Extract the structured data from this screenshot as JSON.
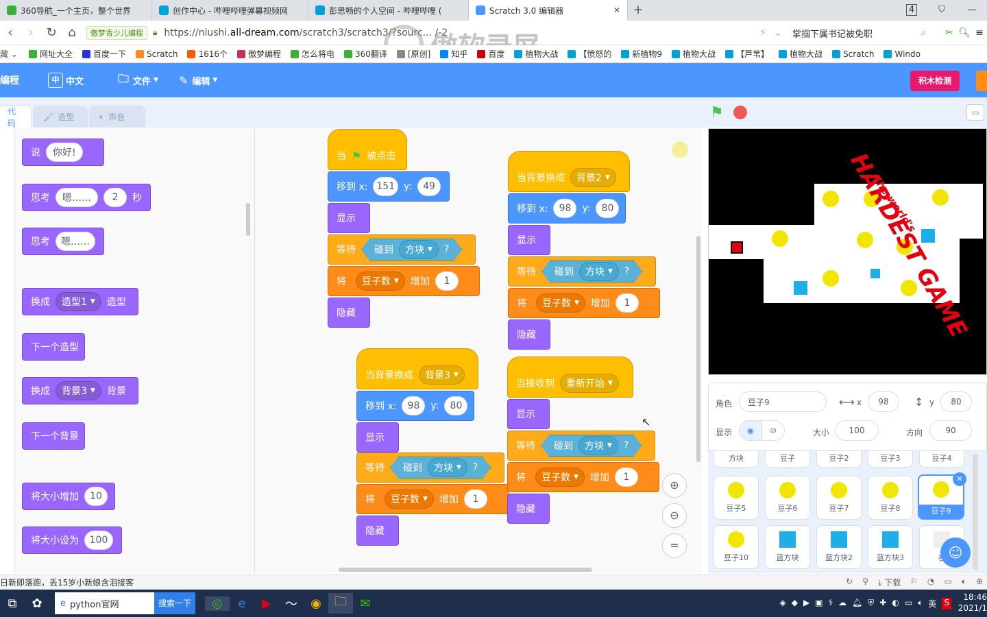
{
  "browser": {
    "tabs": [
      {
        "title": "360导航_一个主页，整个世界",
        "icon_color": "#3cb034",
        "active": false
      },
      {
        "title": "创作中心 - 哔哩哔哩弹幕视频网",
        "icon_color": "#00a1d6",
        "active": false
      },
      {
        "title": "彭思畅的个人空间 - 哔哩哔哩 (",
        "icon_color": "#00a1d6",
        "active": false
      },
      {
        "title": "Scratch 3.0 编辑器",
        "icon_color": "#4c97ff",
        "active": true
      }
    ],
    "new_tab": "+",
    "tab_count": "4",
    "site_badge": "傲梦青少儿编程",
    "url_prefix": "https://niushi.",
    "url_domain": "all-dream.com",
    "url_suffix": "/scratch3/scratch3/?sourc... /-2",
    "search_text": "掌掴下属书记被免职",
    "bookmarks": [
      "网址大全",
      "百度一下",
      "Scratch",
      "1616个",
      "傲梦编程",
      "怎么将电",
      "360翻译",
      "[原创]",
      "知乎",
      "百度",
      "植物大战",
      "【愤怒的",
      "新植物9",
      "植物大战",
      "【芦苇】",
      "植物大战",
      "Scratch",
      "Windo"
    ],
    "watermark": "傲软录屏"
  },
  "menubar": {
    "logo": "编程",
    "lang": "中文",
    "lang_icon": "中",
    "file": "文件",
    "edit": "编辑",
    "check_button": "积木检测"
  },
  "editor_tabs": {
    "code": "代码",
    "costumes": "造型",
    "sounds": "声音"
  },
  "palette": {
    "say": {
      "label": "说",
      "value": "你好!"
    },
    "think_secs": {
      "label": "思考",
      "value": "嗯……",
      "secs": "2",
      "unit": "秒"
    },
    "think": {
      "label": "思考",
      "value": "嗯……"
    },
    "switch_costume": {
      "label": "换成",
      "value": "造型1",
      "suffix": "造型"
    },
    "next_costume": "下一个造型",
    "switch_backdrop": {
      "label": "换成",
      "value": "背景3",
      "suffix": "背景"
    },
    "next_backdrop": "下一个背景",
    "change_size": {
      "label": "将大小增加",
      "value": "10"
    },
    "set_size": {
      "label": "将大小设为",
      "value": "100"
    }
  },
  "scripts": {
    "s1": {
      "hat": "当",
      "hat_suffix": "被点击",
      "goto_label": "移到 x:",
      "x": "151",
      "y_label": "y:",
      "y": "49",
      "show": "显示",
      "wait": "等待",
      "touch": "碰到",
      "target": "方块",
      "q": "?",
      "change": "将",
      "var": "豆子数",
      "inc": "增加",
      "amount": "1",
      "hide": "隐藏"
    },
    "s2": {
      "hat": "当背景换成",
      "backdrop": "背景2",
      "goto_label": "移到 x:",
      "x": "98",
      "y_label": "y:",
      "y": "80",
      "show": "显示",
      "wait": "等待",
      "touch": "碰到",
      "target": "方块",
      "q": "?",
      "change": "将",
      "var": "豆子数",
      "inc": "增加",
      "amount": "1",
      "hide": "隐藏"
    },
    "s3": {
      "hat": "当背景换成",
      "backdrop": "背景3",
      "goto_label": "移到 x:",
      "x": "98",
      "y_label": "y:",
      "y": "80",
      "show": "显示",
      "wait": "等待",
      "touch": "碰到",
      "target": "方块",
      "q": "?",
      "change": "将",
      "var": "豆子数",
      "inc": "增加",
      "amount": "1",
      "hide": "隐藏"
    },
    "s4": {
      "hat": "当接收到",
      "message": "重新开始",
      "show": "显示",
      "wait": "等待",
      "touch": "碰到",
      "target": "方块",
      "q": "?",
      "change": "将",
      "var": "豆子数",
      "inc": "增加",
      "amount": "1",
      "hide": "隐藏"
    }
  },
  "stage": {
    "title_small": "The world's",
    "title_big": "HARDEST GAME"
  },
  "sprite_info": {
    "sprite_label": "角色",
    "sprite_name": "豆子9",
    "x_label": "x",
    "x": "98",
    "y_label": "y",
    "y": "80",
    "show_label": "显示",
    "size_label": "大小",
    "size": "100",
    "direction_label": "方向",
    "direction": "90"
  },
  "sprites_top": [
    "方块",
    "豆子",
    "豆子2",
    "豆子3",
    "豆子4"
  ],
  "sprites_row1": [
    "豆子5",
    "豆子6",
    "豆子7",
    "豆子8",
    "豆子9"
  ],
  "sprites_row2": [
    "豆子10",
    "蓝方块",
    "蓝方块2",
    "蓝方块3",
    "名"
  ],
  "status_text": "日新即落跑，丢15岁小新娘含泪接客",
  "status_right": "下载",
  "taskbar": {
    "browser_item": "python官网",
    "search_btn": "搜索一下",
    "time": "18:46",
    "date": "2021/1",
    "ime": "英"
  }
}
